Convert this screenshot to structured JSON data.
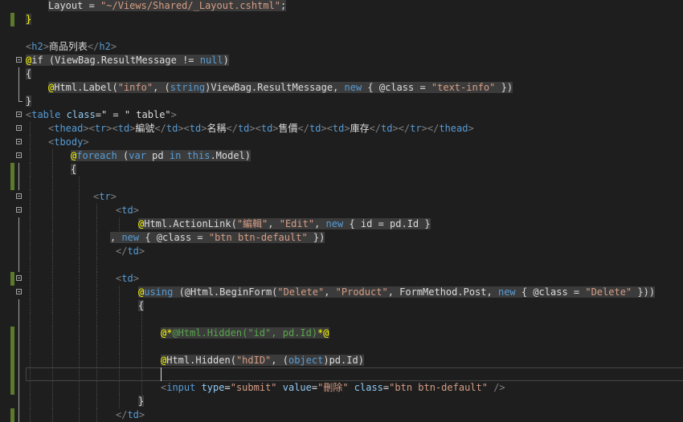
{
  "colors": {
    "text": "#dcdcdc",
    "keyword": "#569cd6",
    "string": "#d69d85",
    "tag_bracket": "#808080",
    "tag_name": "#569cd6",
    "attribute": "#92caf4",
    "razor_marker": "#ffff00",
    "razor_comment_marker": "#ffff00",
    "comment": "#57a64a",
    "type": "#4ec9b0",
    "member": "#dcdcdc",
    "change_marker": "#5b7a2c",
    "highlight_bg": "#3b3b3b"
  },
  "editor": {
    "lines": [
      {
        "tokens": [
          {
            "t": "Layout = ",
            "c": "text",
            "hl": true
          },
          {
            "t": "\"~/Views/Shared/_Layout.cshtml\"",
            "c": "string",
            "hl": true
          },
          {
            "t": ";",
            "c": "text",
            "hl": true
          }
        ]
      },
      {
        "tokens": [
          {
            "t": "}",
            "c": "razor_marker",
            "hl": true
          }
        ]
      },
      {
        "tokens": []
      },
      {
        "tokens": [
          {
            "t": "<",
            "c": "tag_bracket"
          },
          {
            "t": "h2",
            "c": "tag_name"
          },
          {
            "t": ">",
            "c": "tag_bracket"
          },
          {
            "t": "商品列表",
            "c": "text"
          },
          {
            "t": "</",
            "c": "tag_bracket"
          },
          {
            "t": "h2",
            "c": "tag_name"
          },
          {
            "t": ">",
            "c": "tag_bracket"
          }
        ]
      },
      {
        "tokens": [
          {
            "t": "@",
            "c": "razor_marker",
            "hl": true
          },
          {
            "t": "if (ViewBag.ResultMessage != ",
            "c": "text",
            "hl": true
          },
          {
            "t": "null",
            "c": "keyword",
            "hl": true
          },
          {
            "t": ")",
            "c": "text",
            "hl": true
          }
        ]
      },
      {
        "tokens": [
          {
            "t": "{",
            "c": "text",
            "hl": true
          }
        ]
      },
      {
        "tokens": [
          {
            "t": "@",
            "c": "razor_marker",
            "hl": true
          },
          {
            "t": "Html.Label(",
            "c": "text",
            "hl": true
          },
          {
            "t": "\"info\"",
            "c": "string",
            "hl": true
          },
          {
            "t": ", (",
            "c": "text",
            "hl": true
          },
          {
            "t": "string",
            "c": "keyword",
            "hl": true
          },
          {
            "t": ")ViewBag.ResultMessage, ",
            "c": "text",
            "hl": true
          },
          {
            "t": "new",
            "c": "keyword",
            "hl": true
          },
          {
            "t": " { @class = ",
            "c": "text",
            "hl": true
          },
          {
            "t": "\"text-info\"",
            "c": "string",
            "hl": true
          },
          {
            "t": " })",
            "c": "text",
            "hl": true
          }
        ]
      },
      {
        "tokens": [
          {
            "t": "}",
            "c": "text",
            "hl": true
          }
        ]
      },
      {
        "tokens": [
          {
            "t": "<",
            "c": "tag_bracket"
          },
          {
            "t": "table",
            "c": "tag_name"
          },
          {
            "t": " class",
            "c": "attribute"
          },
          {
            "t": "=\" = \" table\"",
            "c": "text"
          },
          {
            "t": ">",
            "c": "tag_bracket"
          }
        ]
      },
      {
        "tokens": [
          {
            "t": "<",
            "c": "tag_bracket"
          },
          {
            "t": "thead",
            "c": "tag_name"
          },
          {
            "t": "><",
            "c": "tag_bracket"
          },
          {
            "t": "tr",
            "c": "tag_name"
          },
          {
            "t": "><",
            "c": "tag_bracket"
          },
          {
            "t": "td",
            "c": "tag_name"
          },
          {
            "t": ">",
            "c": "tag_bracket"
          },
          {
            "t": "編號",
            "c": "text"
          },
          {
            "t": "</",
            "c": "tag_bracket"
          },
          {
            "t": "td",
            "c": "tag_name"
          },
          {
            "t": "><",
            "c": "tag_bracket"
          },
          {
            "t": "td",
            "c": "tag_name"
          },
          {
            "t": ">",
            "c": "tag_bracket"
          },
          {
            "t": "名稱",
            "c": "text"
          },
          {
            "t": "</",
            "c": "tag_bracket"
          },
          {
            "t": "td",
            "c": "tag_name"
          },
          {
            "t": "><",
            "c": "tag_bracket"
          },
          {
            "t": "td",
            "c": "tag_name"
          },
          {
            "t": ">",
            "c": "tag_bracket"
          },
          {
            "t": "售價",
            "c": "text"
          },
          {
            "t": "</",
            "c": "tag_bracket"
          },
          {
            "t": "td",
            "c": "tag_name"
          },
          {
            "t": "><",
            "c": "tag_bracket"
          },
          {
            "t": "td",
            "c": "tag_name"
          },
          {
            "t": ">",
            "c": "tag_bracket"
          },
          {
            "t": "庫存",
            "c": "text"
          },
          {
            "t": "</",
            "c": "tag_bracket"
          },
          {
            "t": "td",
            "c": "tag_name"
          },
          {
            "t": "></",
            "c": "tag_bracket"
          },
          {
            "t": "tr",
            "c": "tag_name"
          },
          {
            "t": "></",
            "c": "tag_bracket"
          },
          {
            "t": "thead",
            "c": "tag_name"
          },
          {
            "t": ">",
            "c": "tag_bracket"
          }
        ]
      },
      {
        "tokens": [
          {
            "t": "<",
            "c": "tag_bracket"
          },
          {
            "t": "tbody",
            "c": "tag_name"
          },
          {
            "t": ">",
            "c": "tag_bracket"
          }
        ]
      },
      {
        "tokens": [
          {
            "t": "@",
            "c": "razor_marker",
            "hl": true
          },
          {
            "t": "foreach",
            "c": "keyword",
            "hl": true
          },
          {
            "t": " (",
            "c": "text",
            "hl": true
          },
          {
            "t": "var",
            "c": "keyword",
            "hl": true
          },
          {
            "t": " pd ",
            "c": "text",
            "hl": true
          },
          {
            "t": "in",
            "c": "keyword",
            "hl": true
          },
          {
            "t": " ",
            "c": "text",
            "hl": true
          },
          {
            "t": "this",
            "c": "keyword",
            "hl": true
          },
          {
            "t": ".Model)",
            "c": "text",
            "hl": true
          }
        ]
      },
      {
        "tokens": [
          {
            "t": "{",
            "c": "text",
            "hl": true
          }
        ]
      },
      {
        "tokens": []
      },
      {
        "tokens": [
          {
            "t": "<",
            "c": "tag_bracket"
          },
          {
            "t": "tr",
            "c": "tag_name"
          },
          {
            "t": ">",
            "c": "tag_bracket"
          }
        ]
      },
      {
        "tokens": [
          {
            "t": "<",
            "c": "tag_bracket"
          },
          {
            "t": "td",
            "c": "tag_name"
          },
          {
            "t": ">",
            "c": "tag_bracket"
          }
        ]
      },
      {
        "tokens": [
          {
            "t": "@",
            "c": "razor_marker",
            "hl": true
          },
          {
            "t": "Html.ActionLink(",
            "c": "text",
            "hl": true
          },
          {
            "t": "\"編輯\"",
            "c": "string",
            "hl": true
          },
          {
            "t": ", ",
            "c": "text",
            "hl": true
          },
          {
            "t": "\"Edit\"",
            "c": "string",
            "hl": true
          },
          {
            "t": ", ",
            "c": "text",
            "hl": true
          },
          {
            "t": "new",
            "c": "keyword",
            "hl": true
          },
          {
            "t": " { id = pd.Id }",
            "c": "text",
            "hl": true
          }
        ]
      },
      {
        "tokens": [
          {
            "t": ", ",
            "c": "text",
            "hl": true
          },
          {
            "t": "new",
            "c": "keyword",
            "hl": true
          },
          {
            "t": " { @class = ",
            "c": "text",
            "hl": true
          },
          {
            "t": "\"btn btn-default\"",
            "c": "string",
            "hl": true
          },
          {
            "t": " })",
            "c": "text",
            "hl": true
          }
        ]
      },
      {
        "tokens": [
          {
            "t": "</",
            "c": "tag_bracket"
          },
          {
            "t": "td",
            "c": "tag_name"
          },
          {
            "t": ">",
            "c": "tag_bracket"
          }
        ]
      },
      {
        "tokens": []
      },
      {
        "tokens": [
          {
            "t": "<",
            "c": "tag_bracket"
          },
          {
            "t": "td",
            "c": "tag_name"
          },
          {
            "t": ">",
            "c": "tag_bracket"
          }
        ]
      },
      {
        "tokens": [
          {
            "t": "@",
            "c": "razor_marker",
            "hl": true
          },
          {
            "t": "using",
            "c": "keyword",
            "hl": true
          },
          {
            "t": " (@Html.BeginForm(",
            "c": "text",
            "hl": true
          },
          {
            "t": "\"Delete\"",
            "c": "string",
            "hl": true
          },
          {
            "t": ", ",
            "c": "text",
            "hl": true
          },
          {
            "t": "\"Product\"",
            "c": "string",
            "hl": true
          },
          {
            "t": ", FormMethod.Post, ",
            "c": "text",
            "hl": true
          },
          {
            "t": "new",
            "c": "keyword",
            "hl": true
          },
          {
            "t": " { @class = ",
            "c": "text",
            "hl": true
          },
          {
            "t": "\"Delete\"",
            "c": "string",
            "hl": true
          },
          {
            "t": " }))",
            "c": "text",
            "hl": true
          }
        ]
      },
      {
        "tokens": [
          {
            "t": "{",
            "c": "text",
            "hl": true
          }
        ]
      },
      {
        "tokens": []
      },
      {
        "tokens": [
          {
            "t": "@*",
            "c": "razor_comment_marker",
            "hl": true
          },
          {
            "t": "@Html.Hidden(\"id\", pd.Id)",
            "c": "comment",
            "hl": true
          },
          {
            "t": "*@",
            "c": "razor_comment_marker",
            "hl": true
          }
        ]
      },
      {
        "tokens": []
      },
      {
        "tokens": [
          {
            "t": "@",
            "c": "razor_marker",
            "hl": true
          },
          {
            "t": "Html.Hidden(",
            "c": "text",
            "hl": true
          },
          {
            "t": "\"hdID\"",
            "c": "string",
            "hl": true
          },
          {
            "t": ", (",
            "c": "text",
            "hl": true
          },
          {
            "t": "object",
            "c": "keyword",
            "hl": true
          },
          {
            "t": ")pd.Id)",
            "c": "text",
            "hl": true
          }
        ]
      },
      {
        "tokens": []
      },
      {
        "tokens": [
          {
            "t": "<",
            "c": "tag_bracket"
          },
          {
            "t": "input",
            "c": "tag_name"
          },
          {
            "t": " type",
            "c": "attribute"
          },
          {
            "t": "=",
            "c": "text"
          },
          {
            "t": "\"submit\"",
            "c": "string"
          },
          {
            "t": " value",
            "c": "attribute"
          },
          {
            "t": "=",
            "c": "text"
          },
          {
            "t": "\"刪除\"",
            "c": "string"
          },
          {
            "t": " class",
            "c": "attribute"
          },
          {
            "t": "=",
            "c": "text"
          },
          {
            "t": "\"btn btn-default\"",
            "c": "string"
          },
          {
            "t": " />",
            "c": "tag_bracket"
          }
        ]
      },
      {
        "tokens": [
          {
            "t": "}",
            "c": "text",
            "hl": true
          }
        ]
      },
      {
        "tokens": [
          {
            "t": "</",
            "c": "tag_bracket"
          },
          {
            "t": "td",
            "c": "tag_name"
          },
          {
            "t": ">",
            "c": "tag_bracket"
          }
        ]
      }
    ]
  }
}
